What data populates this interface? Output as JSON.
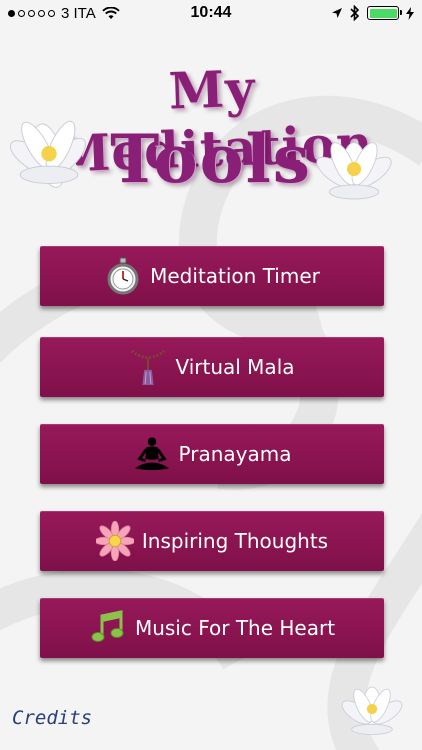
{
  "status_bar": {
    "carrier": "3 ITA",
    "time": "10:44",
    "signal_bars": 1,
    "signal_total": 5,
    "battery_level": 1.0,
    "battery_color": "#4cd964"
  },
  "header": {
    "title_line1": "My Meditation",
    "title_line2": "Tools",
    "title_color": "#8a1f78"
  },
  "menu": {
    "button_color": "#8b1554",
    "items": [
      {
        "label": "Meditation Timer",
        "icon": "stopwatch-icon"
      },
      {
        "label": "Virtual Mala",
        "icon": "mala-beads-icon"
      },
      {
        "label": "Pranayama",
        "icon": "meditating-person-icon"
      },
      {
        "label": "Inspiring Thoughts",
        "icon": "pink-daisy-icon"
      },
      {
        "label": "Music For The Heart",
        "icon": "music-note-icon"
      }
    ]
  },
  "footer": {
    "credits_label": "Credits",
    "credits_color": "#2b3f7a"
  }
}
